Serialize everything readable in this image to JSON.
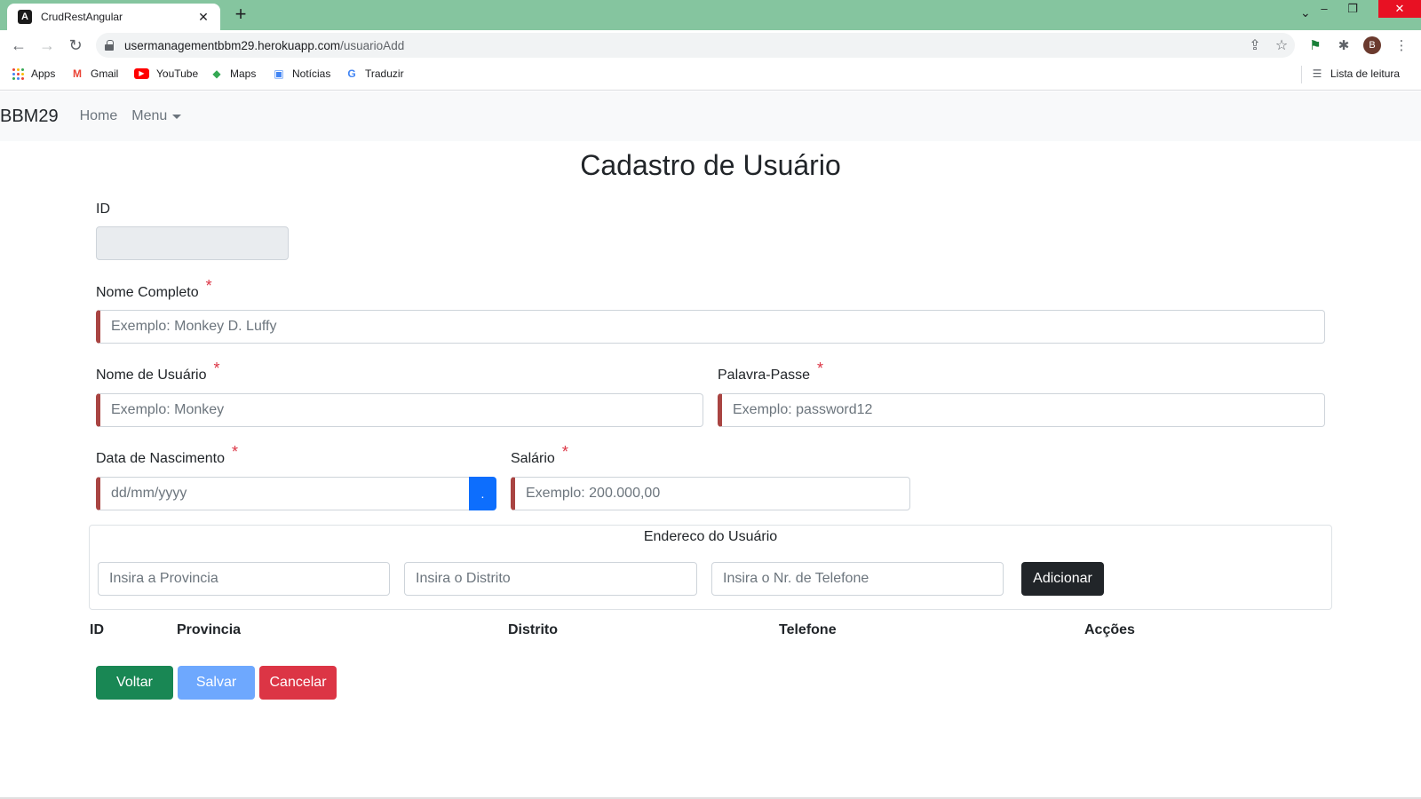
{
  "browser": {
    "tab_title": "CrudRestAngular",
    "tab_close": "✕",
    "new_tab": "+",
    "url_host": "usermanagementbbm29.herokuapp.com",
    "url_path": "/usuarioAdd",
    "profile_initial": "B",
    "bookmarks": [
      "Apps",
      "Gmail",
      "YouTube",
      "Maps",
      "Notícias",
      "Traduzir"
    ],
    "reading_list": "Lista de leitura"
  },
  "navbar": {
    "brand": "BBM29",
    "home": "Home",
    "menu": "Menu"
  },
  "page": {
    "title": "Cadastro de Usuário"
  },
  "form": {
    "id_label": "ID",
    "id_value": "",
    "nome_completo_label": "Nome Completo",
    "nome_completo_placeholder": "Exemplo: Monkey D. Luffy",
    "nome_usuario_label": "Nome de Usuário",
    "nome_usuario_placeholder": "Exemplo: Monkey",
    "palavra_passe_label": "Palavra-Passe",
    "palavra_passe_placeholder": "Exemplo: password12",
    "data_nascimento_label": "Data de Nascimento",
    "data_nascimento_placeholder": "dd/mm/yyyy",
    "date_picker_label": ".",
    "salario_label": "Salário",
    "salario_placeholder": "Exemplo: 200.000,00",
    "required_mark": "*"
  },
  "address": {
    "legend": "Endereco do Usuário",
    "provincia_placeholder": "Insira a Provincia",
    "distrito_placeholder": "Insira o Distrito",
    "telefone_placeholder": "Insira o Nr. de Telefone",
    "add_button": "Adicionar"
  },
  "table": {
    "headers": [
      "ID",
      "Provincia",
      "Distrito",
      "Telefone",
      "Acções"
    ]
  },
  "actions": {
    "voltar": "Voltar",
    "salvar": "Salvar",
    "cancelar": "Cancelar"
  },
  "colors": {
    "tabbar": "#85c59f",
    "invalid_border": "#a94442",
    "success": "#198754",
    "primary_disabled": "#6ea8fe",
    "danger": "#dc3545",
    "dark": "#212529"
  }
}
